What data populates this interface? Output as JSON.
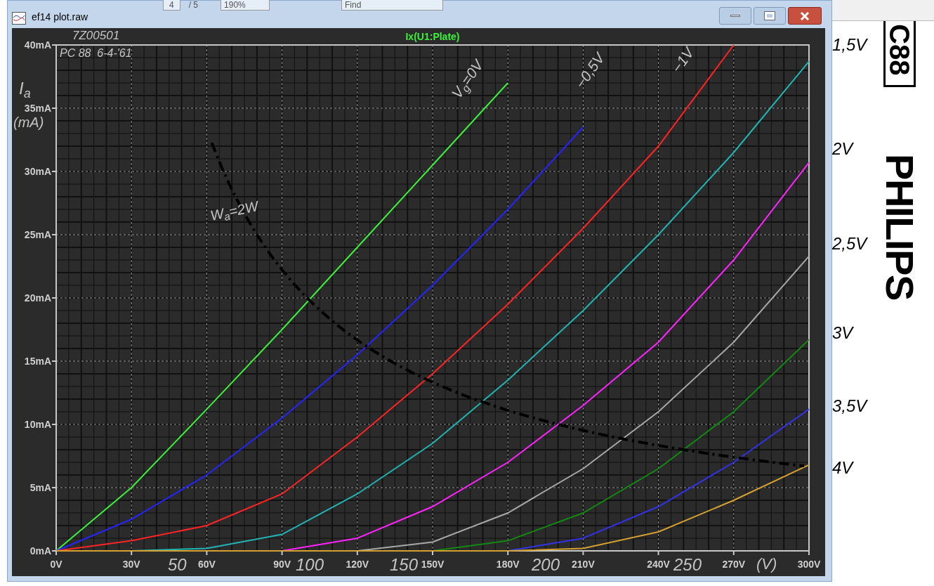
{
  "toolbar": {
    "page": "4",
    "pages": "/ 5",
    "zoom": "190%",
    "search": {
      "placeholder": "Find"
    }
  },
  "window": {
    "title": "ef14 plot.raw"
  },
  "plot": {
    "chart_data": {
      "type": "line",
      "title": "Ix(U1:Plate)",
      "grid": true,
      "x": [
        0,
        30,
        60,
        90,
        120,
        150,
        180,
        210,
        240,
        270,
        300
      ],
      "xlim": [
        0,
        300
      ],
      "ylim": [
        0,
        40
      ],
      "xticks": [
        {
          "value": 0,
          "label": "0V"
        },
        {
          "value": 30,
          "label": "30V"
        },
        {
          "value": 60,
          "label": "60V"
        },
        {
          "value": 90,
          "label": "90V"
        },
        {
          "value": 120,
          "label": "120V"
        },
        {
          "value": 150,
          "label": "150V"
        },
        {
          "value": 180,
          "label": "180V"
        },
        {
          "value": 210,
          "label": "210V"
        },
        {
          "value": 240,
          "label": "240V"
        },
        {
          "value": 270,
          "label": "270V"
        },
        {
          "value": 300,
          "label": "300V"
        }
      ],
      "yticks": [
        {
          "value": 0,
          "label": "0mA"
        },
        {
          "value": 5,
          "label": "5mA"
        },
        {
          "value": 10,
          "label": "10mA"
        },
        {
          "value": 15,
          "label": "15mA"
        },
        {
          "value": 20,
          "label": "20mA"
        },
        {
          "value": 25,
          "label": "25mA"
        },
        {
          "value": 30,
          "label": "30mA"
        },
        {
          "value": 35,
          "label": "35mA"
        },
        {
          "value": 40,
          "label": "40mA"
        }
      ],
      "series": [
        {
          "color": "#3cf03c",
          "values": [
            0,
            5,
            11.2,
            17.5,
            24,
            30.5,
            37,
            null,
            null,
            null,
            null
          ]
        },
        {
          "color": "#2424ff",
          "values": [
            0,
            2.5,
            6,
            10.5,
            15.5,
            21,
            27,
            33.5,
            null,
            null,
            null
          ]
        },
        {
          "color": "#ff2424",
          "values": [
            0,
            0.8,
            2,
            4.5,
            9,
            14,
            19.5,
            25.5,
            32,
            40,
            null
          ]
        },
        {
          "color": "#22b4b4",
          "values": [
            null,
            0,
            0.2,
            1.3,
            4.5,
            8.5,
            13.5,
            19,
            25,
            31.5,
            38.7
          ]
        },
        {
          "color": "#ff24ff",
          "values": [
            null,
            null,
            null,
            0,
            1,
            3.5,
            7,
            11.5,
            16.5,
            23,
            30.7
          ]
        },
        {
          "color": "#a8a8a8",
          "values": [
            null,
            null,
            null,
            null,
            0,
            0.7,
            3,
            6.5,
            11,
            16.5,
            23.3
          ]
        },
        {
          "color": "#128a12",
          "values": [
            null,
            null,
            null,
            null,
            null,
            0,
            0.8,
            3,
            6.5,
            11,
            16.7
          ]
        },
        {
          "color": "#3232e6",
          "values": [
            null,
            null,
            null,
            null,
            null,
            null,
            0,
            1,
            3.5,
            7,
            11.2
          ]
        },
        {
          "color": "#d4a030",
          "values": [
            0,
            0,
            0,
            0,
            0,
            0,
            0,
            0.2,
            1.5,
            4,
            6.8
          ]
        }
      ]
    }
  },
  "scan_overlay": {
    "code": "7Z00501",
    "note": "PC 88  6-4-'61",
    "y_label": "I$_{a}$",
    "y_unit": "(mA)",
    "curve_labels": [
      "V$_{g}$=0V",
      "−0,5V",
      "−1V"
    ],
    "power_label": "W$_{a}$=2W",
    "x_numbers": [
      "50",
      "100",
      "150",
      "200",
      "250"
    ],
    "x_unit": "(V)"
  },
  "datasheet": {
    "type_label": "C88",
    "brand": "PHILIPS",
    "curve_labels": [
      "1,5V",
      "2V",
      "2,5V",
      "3V",
      "3,5V",
      "4V"
    ]
  }
}
